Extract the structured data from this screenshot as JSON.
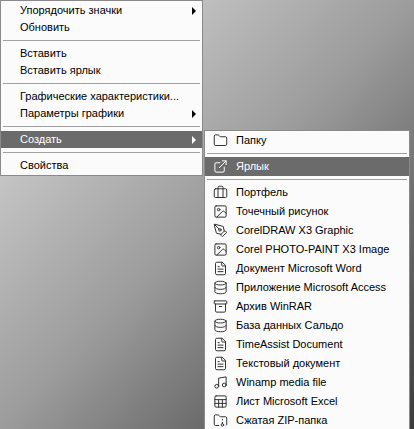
{
  "desktop": {
    "wallpaper": "photo"
  },
  "context_menu": {
    "items": [
      {
        "kind": "item",
        "label": "Упорядочить значки",
        "has_submenu": true,
        "selected": false
      },
      {
        "kind": "item",
        "label": "Обновить",
        "has_submenu": false,
        "selected": false
      },
      {
        "kind": "separator"
      },
      {
        "kind": "item",
        "label": "Вставить",
        "has_submenu": false,
        "selected": false
      },
      {
        "kind": "item",
        "label": "Вставить ярлык",
        "has_submenu": false,
        "selected": false
      },
      {
        "kind": "separator"
      },
      {
        "kind": "item",
        "label": "Графические характеристики...",
        "has_submenu": false,
        "selected": false
      },
      {
        "kind": "item",
        "label": "Параметры графики",
        "has_submenu": true,
        "selected": false
      },
      {
        "kind": "separator"
      },
      {
        "kind": "item",
        "label": "Создать",
        "has_submenu": true,
        "selected": true
      },
      {
        "kind": "separator"
      },
      {
        "kind": "item",
        "label": "Свойства",
        "has_submenu": false,
        "selected": false
      }
    ]
  },
  "submenu": {
    "items": [
      {
        "kind": "item",
        "label": "Папку",
        "selected": false
      },
      {
        "kind": "separator"
      },
      {
        "kind": "item",
        "label": "Ярлык",
        "selected": true
      },
      {
        "kind": "separator"
      },
      {
        "kind": "item",
        "label": "Портфель",
        "selected": false
      },
      {
        "kind": "item",
        "label": "Точечный рисунок",
        "selected": false
      },
      {
        "kind": "item",
        "label": "CorelDRAW X3 Graphic",
        "selected": false
      },
      {
        "kind": "item",
        "label": "Corel PHOTO-PAINT X3 Image",
        "selected": false
      },
      {
        "kind": "item",
        "label": "Документ Microsoft Word",
        "selected": false
      },
      {
        "kind": "item",
        "label": "Приложение Microsoft Access",
        "selected": false
      },
      {
        "kind": "item",
        "label": "Архив WinRAR",
        "selected": false
      },
      {
        "kind": "item",
        "label": "База данных Сальдо",
        "selected": false
      },
      {
        "kind": "item",
        "label": "TimeAssist Document",
        "selected": false
      },
      {
        "kind": "item",
        "label": "Текстовый документ",
        "selected": false
      },
      {
        "kind": "item",
        "label": "Winamp media file",
        "selected": false
      },
      {
        "kind": "item",
        "label": "Лист Microsoft Excel",
        "selected": false
      },
      {
        "kind": "item",
        "label": "Сжатая ZIP-папка",
        "selected": false
      }
    ]
  }
}
